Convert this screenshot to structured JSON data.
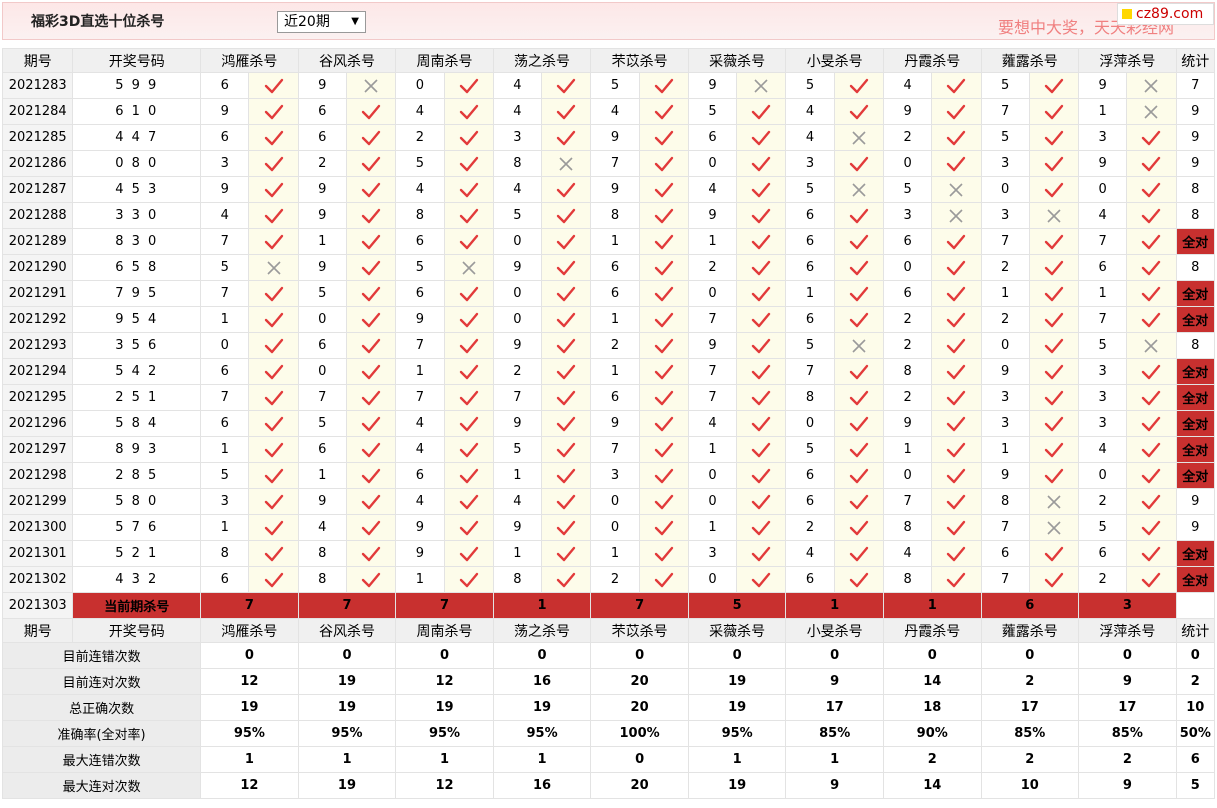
{
  "header": {
    "title": "福彩3D直选十位杀号",
    "period_select": "近20期",
    "slogan": "要想中大奖，天天彩经网",
    "logo": "cz89.com"
  },
  "columns": {
    "issue": "期号",
    "draw": "开奖号码",
    "experts": [
      "鸿雁杀号",
      "谷风杀号",
      "周南杀号",
      "荡之杀号",
      "芣苡杀号",
      "采薇杀号",
      "小旻杀号",
      "丹霞杀号",
      "蕹露杀号",
      "浮萍杀号"
    ],
    "stat": "统计"
  },
  "rows": [
    {
      "issue": "2021283",
      "draw": "5 9 9",
      "kills": [
        [
          "6",
          1
        ],
        [
          "9",
          0
        ],
        [
          "0",
          1
        ],
        [
          "4",
          1
        ],
        [
          "5",
          1
        ],
        [
          "9",
          0
        ],
        [
          "5",
          1
        ],
        [
          "4",
          1
        ],
        [
          "5",
          1
        ],
        [
          "9",
          0
        ]
      ],
      "stat": "7"
    },
    {
      "issue": "2021284",
      "draw": "6 1 0",
      "kills": [
        [
          "9",
          1
        ],
        [
          "6",
          1
        ],
        [
          "4",
          1
        ],
        [
          "4",
          1
        ],
        [
          "4",
          1
        ],
        [
          "5",
          1
        ],
        [
          "4",
          1
        ],
        [
          "9",
          1
        ],
        [
          "7",
          1
        ],
        [
          "1",
          0
        ]
      ],
      "stat": "9"
    },
    {
      "issue": "2021285",
      "draw": "4 4 7",
      "kills": [
        [
          "6",
          1
        ],
        [
          "6",
          1
        ],
        [
          "2",
          1
        ],
        [
          "3",
          1
        ],
        [
          "9",
          1
        ],
        [
          "6",
          1
        ],
        [
          "4",
          0
        ],
        [
          "2",
          1
        ],
        [
          "5",
          1
        ],
        [
          "3",
          1
        ]
      ],
      "stat": "9"
    },
    {
      "issue": "2021286",
      "draw": "0 8 0",
      "kills": [
        [
          "3",
          1
        ],
        [
          "2",
          1
        ],
        [
          "5",
          1
        ],
        [
          "8",
          0
        ],
        [
          "7",
          1
        ],
        [
          "0",
          1
        ],
        [
          "3",
          1
        ],
        [
          "0",
          1
        ],
        [
          "3",
          1
        ],
        [
          "9",
          1
        ]
      ],
      "stat": "9"
    },
    {
      "issue": "2021287",
      "draw": "4 5 3",
      "kills": [
        [
          "9",
          1
        ],
        [
          "9",
          1
        ],
        [
          "4",
          1
        ],
        [
          "4",
          1
        ],
        [
          "9",
          1
        ],
        [
          "4",
          1
        ],
        [
          "5",
          0
        ],
        [
          "5",
          0
        ],
        [
          "0",
          1
        ],
        [
          "0",
          1
        ]
      ],
      "stat": "8"
    },
    {
      "issue": "2021288",
      "draw": "3 3 0",
      "kills": [
        [
          "4",
          1
        ],
        [
          "9",
          1
        ],
        [
          "8",
          1
        ],
        [
          "5",
          1
        ],
        [
          "8",
          1
        ],
        [
          "9",
          1
        ],
        [
          "6",
          1
        ],
        [
          "3",
          0
        ],
        [
          "3",
          0
        ],
        [
          "4",
          1
        ]
      ],
      "stat": "8"
    },
    {
      "issue": "2021289",
      "draw": "8 3 0",
      "kills": [
        [
          "7",
          1
        ],
        [
          "1",
          1
        ],
        [
          "6",
          1
        ],
        [
          "0",
          1
        ],
        [
          "1",
          1
        ],
        [
          "1",
          1
        ],
        [
          "6",
          1
        ],
        [
          "6",
          1
        ],
        [
          "7",
          1
        ],
        [
          "7",
          1
        ]
      ],
      "stat": "全对"
    },
    {
      "issue": "2021290",
      "draw": "6 5 8",
      "kills": [
        [
          "5",
          0
        ],
        [
          "9",
          1
        ],
        [
          "5",
          0
        ],
        [
          "9",
          1
        ],
        [
          "6",
          1
        ],
        [
          "2",
          1
        ],
        [
          "6",
          1
        ],
        [
          "0",
          1
        ],
        [
          "2",
          1
        ],
        [
          "6",
          1
        ]
      ],
      "stat": "8"
    },
    {
      "issue": "2021291",
      "draw": "7 9 5",
      "kills": [
        [
          "7",
          1
        ],
        [
          "5",
          1
        ],
        [
          "6",
          1
        ],
        [
          "0",
          1
        ],
        [
          "6",
          1
        ],
        [
          "0",
          1
        ],
        [
          "1",
          1
        ],
        [
          "6",
          1
        ],
        [
          "1",
          1
        ],
        [
          "1",
          1
        ]
      ],
      "stat": "全对"
    },
    {
      "issue": "2021292",
      "draw": "9 5 4",
      "kills": [
        [
          "1",
          1
        ],
        [
          "0",
          1
        ],
        [
          "9",
          1
        ],
        [
          "0",
          1
        ],
        [
          "1",
          1
        ],
        [
          "7",
          1
        ],
        [
          "6",
          1
        ],
        [
          "2",
          1
        ],
        [
          "2",
          1
        ],
        [
          "7",
          1
        ]
      ],
      "stat": "全对"
    },
    {
      "issue": "2021293",
      "draw": "3 5 6",
      "kills": [
        [
          "0",
          1
        ],
        [
          "6",
          1
        ],
        [
          "7",
          1
        ],
        [
          "9",
          1
        ],
        [
          "2",
          1
        ],
        [
          "9",
          1
        ],
        [
          "5",
          0
        ],
        [
          "2",
          1
        ],
        [
          "0",
          1
        ],
        [
          "5",
          0
        ]
      ],
      "stat": "8"
    },
    {
      "issue": "2021294",
      "draw": "5 4 2",
      "kills": [
        [
          "6",
          1
        ],
        [
          "0",
          1
        ],
        [
          "1",
          1
        ],
        [
          "2",
          1
        ],
        [
          "1",
          1
        ],
        [
          "7",
          1
        ],
        [
          "7",
          1
        ],
        [
          "8",
          1
        ],
        [
          "9",
          1
        ],
        [
          "3",
          1
        ]
      ],
      "stat": "全对"
    },
    {
      "issue": "2021295",
      "draw": "2 5 1",
      "kills": [
        [
          "7",
          1
        ],
        [
          "7",
          1
        ],
        [
          "7",
          1
        ],
        [
          "7",
          1
        ],
        [
          "6",
          1
        ],
        [
          "7",
          1
        ],
        [
          "8",
          1
        ],
        [
          "2",
          1
        ],
        [
          "3",
          1
        ],
        [
          "3",
          1
        ]
      ],
      "stat": "全对"
    },
    {
      "issue": "2021296",
      "draw": "5 8 4",
      "kills": [
        [
          "6",
          1
        ],
        [
          "5",
          1
        ],
        [
          "4",
          1
        ],
        [
          "9",
          1
        ],
        [
          "9",
          1
        ],
        [
          "4",
          1
        ],
        [
          "0",
          1
        ],
        [
          "9",
          1
        ],
        [
          "3",
          1
        ],
        [
          "3",
          1
        ]
      ],
      "stat": "全对"
    },
    {
      "issue": "2021297",
      "draw": "8 9 3",
      "kills": [
        [
          "1",
          1
        ],
        [
          "6",
          1
        ],
        [
          "4",
          1
        ],
        [
          "5",
          1
        ],
        [
          "7",
          1
        ],
        [
          "1",
          1
        ],
        [
          "5",
          1
        ],
        [
          "1",
          1
        ],
        [
          "1",
          1
        ],
        [
          "4",
          1
        ]
      ],
      "stat": "全对"
    },
    {
      "issue": "2021298",
      "draw": "2 8 5",
      "kills": [
        [
          "5",
          1
        ],
        [
          "1",
          1
        ],
        [
          "6",
          1
        ],
        [
          "1",
          1
        ],
        [
          "3",
          1
        ],
        [
          "0",
          1
        ],
        [
          "6",
          1
        ],
        [
          "0",
          1
        ],
        [
          "9",
          1
        ],
        [
          "0",
          1
        ]
      ],
      "stat": "全对"
    },
    {
      "issue": "2021299",
      "draw": "5 8 0",
      "kills": [
        [
          "3",
          1
        ],
        [
          "9",
          1
        ],
        [
          "4",
          1
        ],
        [
          "4",
          1
        ],
        [
          "0",
          1
        ],
        [
          "0",
          1
        ],
        [
          "6",
          1
        ],
        [
          "7",
          1
        ],
        [
          "8",
          0
        ],
        [
          "2",
          1
        ]
      ],
      "stat": "9"
    },
    {
      "issue": "2021300",
      "draw": "5 7 6",
      "kills": [
        [
          "1",
          1
        ],
        [
          "4",
          1
        ],
        [
          "9",
          1
        ],
        [
          "9",
          1
        ],
        [
          "0",
          1
        ],
        [
          "1",
          1
        ],
        [
          "2",
          1
        ],
        [
          "8",
          1
        ],
        [
          "7",
          0
        ],
        [
          "5",
          1
        ]
      ],
      "stat": "9"
    },
    {
      "issue": "2021301",
      "draw": "5 2 1",
      "kills": [
        [
          "8",
          1
        ],
        [
          "8",
          1
        ],
        [
          "9",
          1
        ],
        [
          "1",
          1
        ],
        [
          "1",
          1
        ],
        [
          "3",
          1
        ],
        [
          "4",
          1
        ],
        [
          "4",
          1
        ],
        [
          "6",
          1
        ],
        [
          "6",
          1
        ]
      ],
      "stat": "全对"
    },
    {
      "issue": "2021302",
      "draw": "4 3 2",
      "kills": [
        [
          "6",
          1
        ],
        [
          "8",
          1
        ],
        [
          "1",
          1
        ],
        [
          "8",
          1
        ],
        [
          "2",
          1
        ],
        [
          "0",
          1
        ],
        [
          "6",
          1
        ],
        [
          "8",
          1
        ],
        [
          "7",
          1
        ],
        [
          "2",
          1
        ]
      ],
      "stat": "全对"
    }
  ],
  "current": {
    "issue": "2021303",
    "label": "当前期杀号",
    "kills": [
      "7",
      "7",
      "7",
      "1",
      "7",
      "5",
      "1",
      "1",
      "6",
      "3"
    ]
  },
  "stats": [
    {
      "label": "目前连错次数",
      "values": [
        "0",
        "0",
        "0",
        "0",
        "0",
        "0",
        "0",
        "0",
        "0",
        "0"
      ],
      "total": "0",
      "style": "stv"
    },
    {
      "label": "目前连对次数",
      "values": [
        "12",
        "19",
        "12",
        "16",
        "20",
        "19",
        "9",
        "14",
        "2",
        "9"
      ],
      "total": "2",
      "style": "stv"
    },
    {
      "label": "总正确次数",
      "values": [
        "19",
        "19",
        "19",
        "19",
        "20",
        "19",
        "17",
        "18",
        "17",
        "17"
      ],
      "total": "10",
      "style": "stv"
    },
    {
      "label": "准确率(全对率)",
      "values": [
        "95%",
        "95%",
        "95%",
        "95%",
        "100%",
        "95%",
        "85%",
        "90%",
        "85%",
        "85%"
      ],
      "total": "50%",
      "style": "acc"
    },
    {
      "label": "最大连错次数",
      "values": [
        "1",
        "1",
        "1",
        "1",
        "0",
        "1",
        "1",
        "2",
        "2",
        "2"
      ],
      "total": "6",
      "style": "stv"
    },
    {
      "label": "最大连对次数",
      "values": [
        "12",
        "19",
        "12",
        "16",
        "20",
        "19",
        "9",
        "14",
        "10",
        "9"
      ],
      "total": "5",
      "style": "stv"
    }
  ],
  "colors": {
    "tick": "#e23a3a",
    "cross": "#9a9a9a",
    "badge": "#c8302f",
    "stat_blue": "#1a33aa",
    "stat_red": "#d11111"
  }
}
